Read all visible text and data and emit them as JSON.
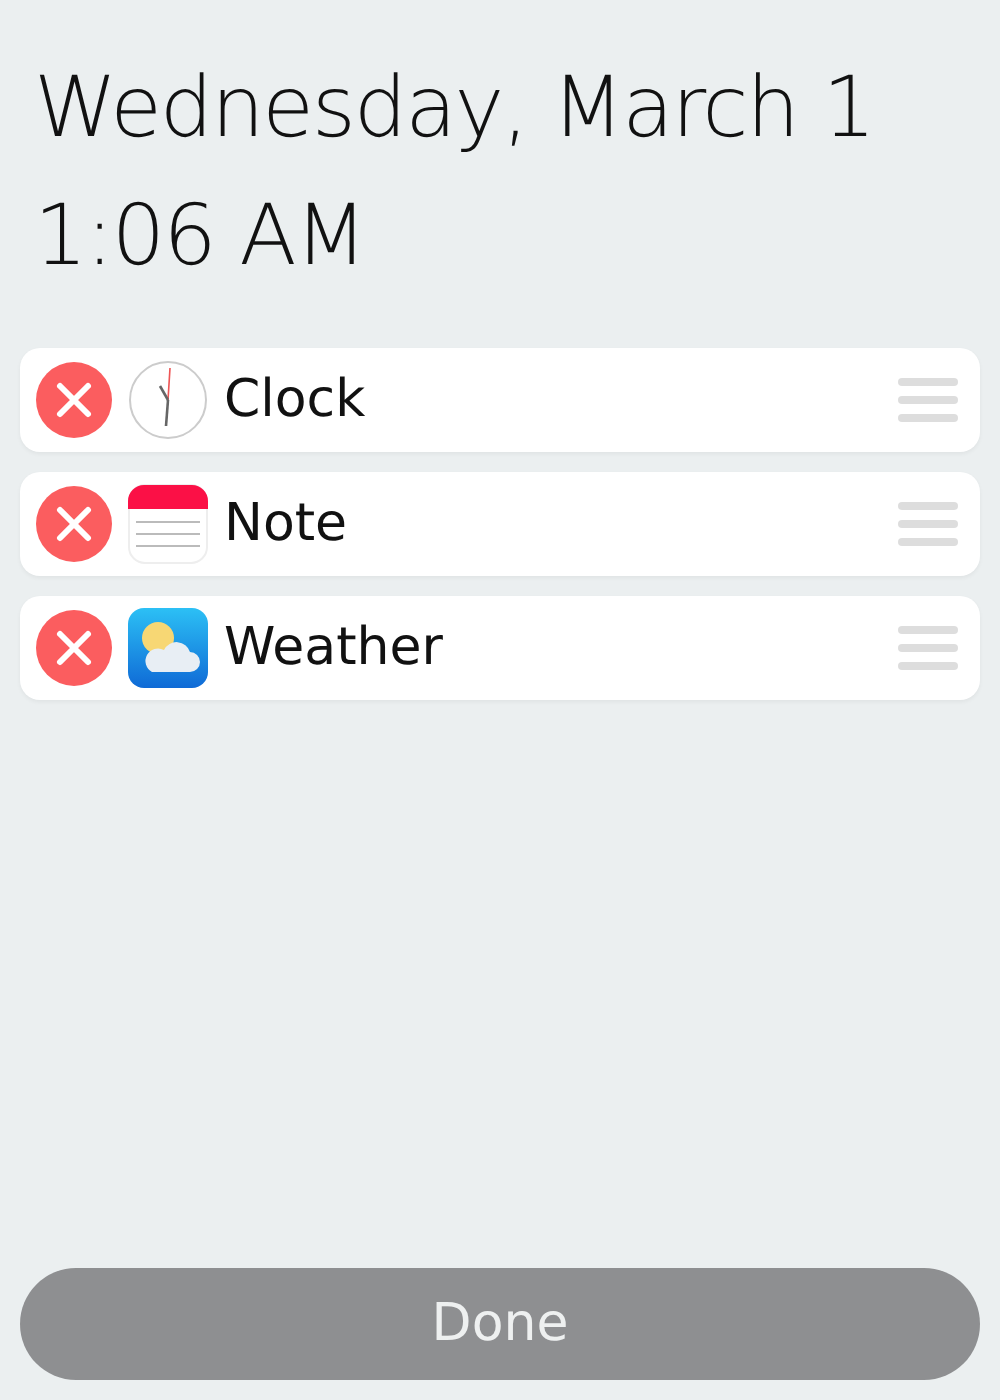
{
  "header": {
    "date": "Wednesday, March 1",
    "time": "1:06 AM"
  },
  "widgets": [
    {
      "name": "Clock",
      "kind": "clock"
    },
    {
      "name": "Note",
      "kind": "note"
    },
    {
      "name": "Weather",
      "kind": "weather"
    }
  ],
  "done_button": {
    "label": "Done"
  }
}
